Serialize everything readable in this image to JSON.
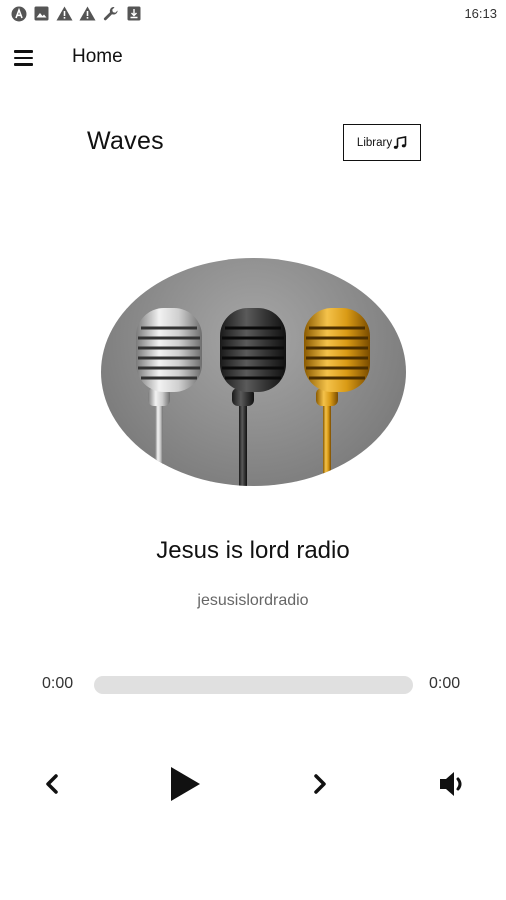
{
  "status_bar": {
    "time": "16:13",
    "icons": [
      "app-a-icon",
      "image-icon",
      "warning-icon",
      "warning-icon",
      "wrench-icon",
      "download-icon"
    ]
  },
  "app_bar": {
    "title": "Home",
    "menu_icon": "hamburger-menu-icon"
  },
  "header": {
    "station_group": "Waves",
    "library_label": "Library",
    "library_icon": "music-note-icon"
  },
  "player": {
    "artwork": "three-microphones-image",
    "title": "Jesus is lord radio",
    "subtitle": "jesusislordradio",
    "position": "0:00",
    "duration": "0:00",
    "progress": 0,
    "controls": {
      "previous_icon": "chevron-left-icon",
      "play_icon": "play-icon",
      "next_icon": "chevron-right-icon",
      "volume_icon": "volume-icon"
    }
  }
}
